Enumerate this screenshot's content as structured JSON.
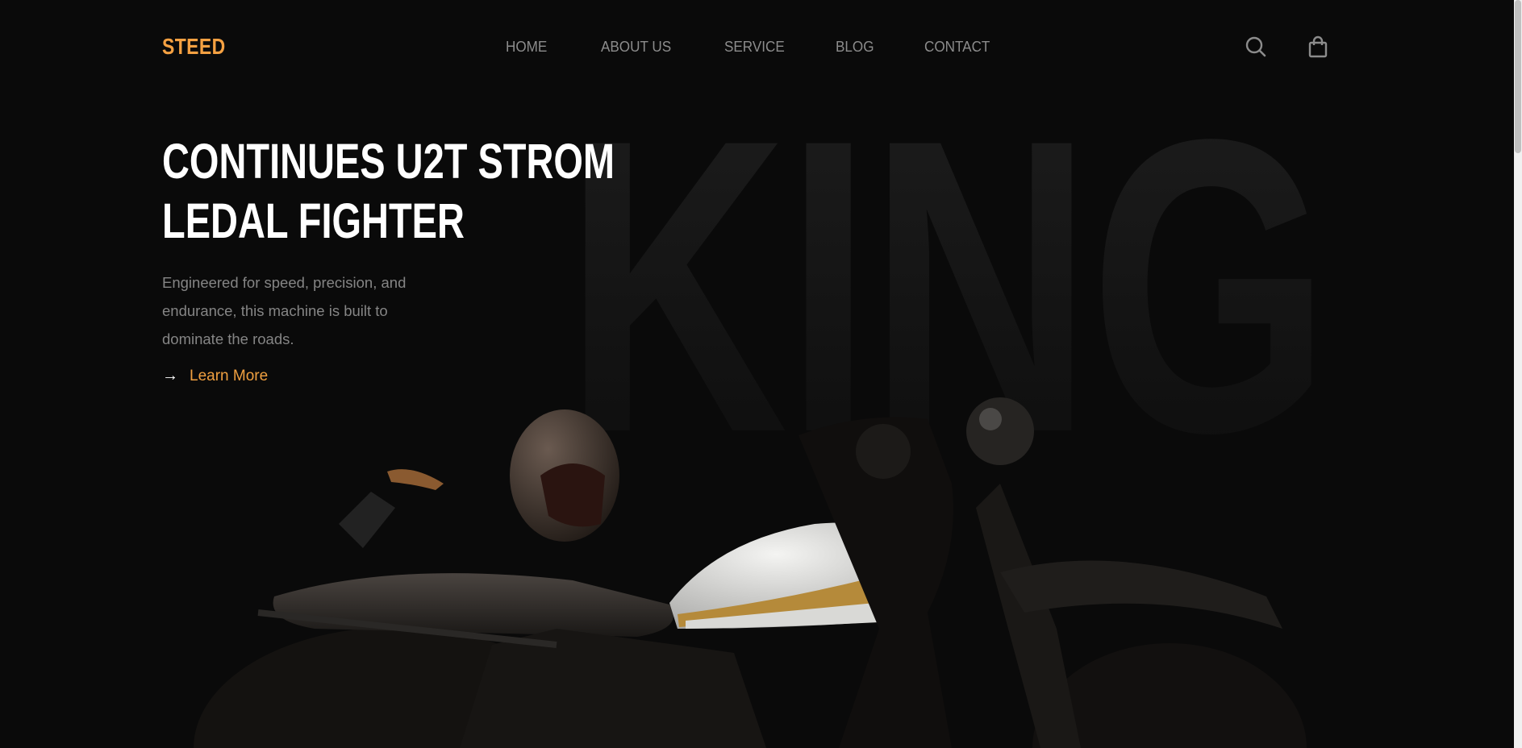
{
  "brand": {
    "name": "STEED",
    "accent": "#f5a142"
  },
  "nav": {
    "items": [
      {
        "label": "HOME"
      },
      {
        "label": "ABOUT US"
      },
      {
        "label": "SERVICE"
      },
      {
        "label": "BLOG"
      },
      {
        "label": "CONTACT"
      }
    ]
  },
  "header_icons": [
    "search-icon",
    "shopping-bag-icon"
  ],
  "hero": {
    "background_word": "KING",
    "title_line1": "CONTINUES U2T STROM",
    "title_line2": "LEDAL FIGHTER",
    "description": "Engineered for speed, precision, and endurance, this machine is built to dominate the roads.",
    "cta_label": "Learn More",
    "cta_arrow": "→"
  }
}
